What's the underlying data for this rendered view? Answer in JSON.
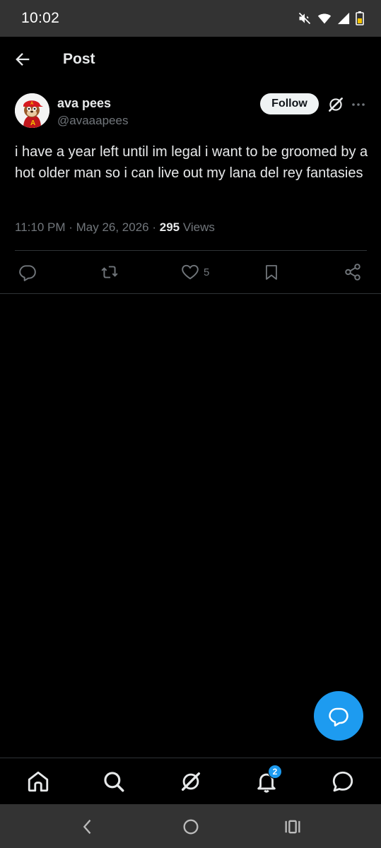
{
  "status_bar": {
    "time": "10:02",
    "icons": [
      "mute-icon",
      "wifi-icon",
      "signal-icon",
      "battery-icon"
    ]
  },
  "header": {
    "title": "Post",
    "back_icon": "arrow-left-icon"
  },
  "post": {
    "author": {
      "name": "ava pees",
      "handle": "@avaaapees"
    },
    "follow_label": "Follow",
    "text": "i have a year left until im legal i want to be groomed by a hot older man so i can live out my lana del rey fantasies",
    "meta": {
      "time_date": "11:10 PM · May 26, 2026 · ",
      "views_count": "295",
      "views_label": " Views"
    },
    "actions": {
      "reply": {
        "icon": "reply-icon",
        "count": ""
      },
      "repost": {
        "icon": "repost-icon",
        "count": ""
      },
      "like": {
        "icon": "heart-icon",
        "count": "5"
      },
      "bookmark": {
        "icon": "bookmark-icon",
        "count": ""
      },
      "share": {
        "icon": "share-icon",
        "count": ""
      }
    }
  },
  "bottom_nav": {
    "items": [
      "home-icon",
      "search-icon",
      "grok-icon",
      "notifications-icon",
      "messages-icon"
    ],
    "notification_badge": "2"
  },
  "colors": {
    "background": "#000000",
    "accent": "#1d9bf0",
    "secondary_text": "#71767b",
    "primary_text": "#e7e9ea",
    "system_bar": "#333333"
  }
}
